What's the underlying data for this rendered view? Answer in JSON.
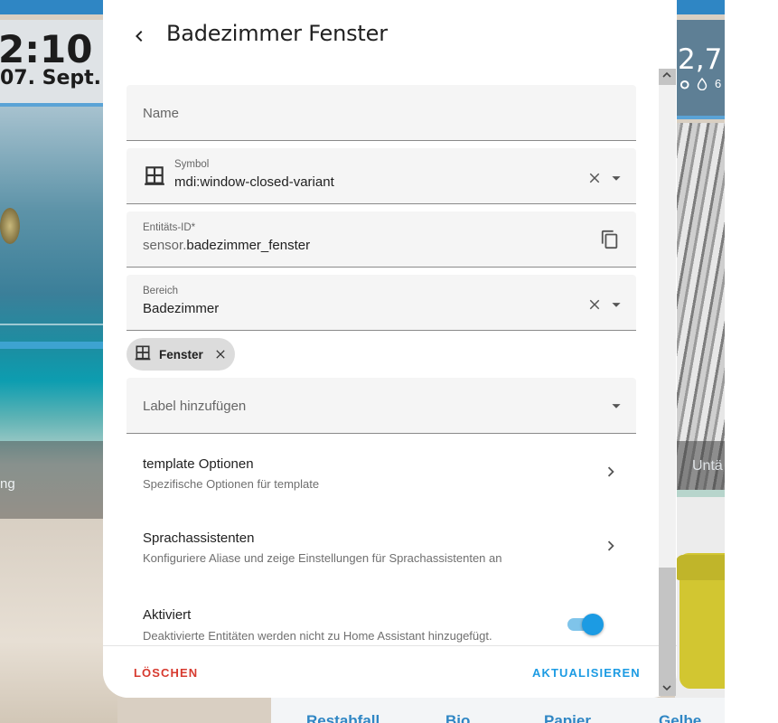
{
  "background": {
    "clock": "2:10",
    "date": "07. Sept.",
    "left_caption": "ng",
    "temperature": "2,7 °",
    "humidity": "6",
    "right_caption": "Untä",
    "bottom_labels": [
      "Restabfall",
      "Bio",
      "Papier",
      "Gelbe"
    ]
  },
  "dialog": {
    "title": "Badezimmer Fenster",
    "fields": {
      "name": {
        "placeholder": "Name"
      },
      "symbol": {
        "label": "Symbol",
        "value": "mdi:window-closed-variant"
      },
      "entity_id": {
        "label": "Entitäts-ID*",
        "prefix": "sensor.",
        "value": "badezimmer_fenster"
      },
      "area": {
        "label": "Bereich",
        "value": "Badezimmer"
      },
      "labels": {
        "placeholder": "Label hinzufügen"
      }
    },
    "chip": {
      "label": "Fenster"
    },
    "rows": [
      {
        "title": "template Optionen",
        "subtitle": "Spezifische Optionen für template"
      },
      {
        "title": "Sprachassistenten",
        "subtitle": "Konfiguriere Aliase und zeige Einstellungen für Sprachassistenten an"
      }
    ],
    "enabled": {
      "title": "Aktiviert",
      "subtitle": "Deaktivierte Entitäten werden nicht zu Home Assistant hinzugefügt.",
      "state": true
    },
    "buttons": {
      "delete": "LÖSCHEN",
      "update": "AKTUALISIEREN"
    }
  },
  "colors": {
    "accent": "#1c9be3",
    "danger": "#d73a2f",
    "field_bg": "#f5f5f5"
  }
}
